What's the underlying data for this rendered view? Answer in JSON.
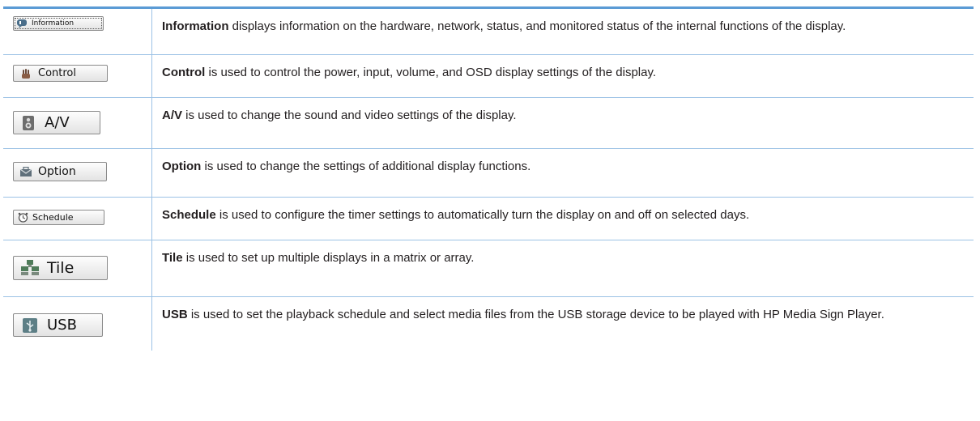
{
  "rows": [
    {
      "button_label": "Information",
      "icon": "info-speech-icon",
      "term": "Information",
      "description": " displays information on the hardware, network, status, and monitored status of the internal functions of the display."
    },
    {
      "button_label": "Control",
      "icon": "hand-icon",
      "term": "Control",
      "description": " is used to control the power, input, volume, and OSD display settings of the display."
    },
    {
      "button_label": "A/V",
      "icon": "speaker-icon",
      "term": "A/V",
      "description": " is used to change the sound and video settings of the display."
    },
    {
      "button_label": "Option",
      "icon": "toolbox-icon",
      "term": "Option",
      "description": " is used to change the settings of additional display functions."
    },
    {
      "button_label": "Schedule",
      "icon": "clock-icon",
      "term": "Schedule",
      "description": " is used to configure the timer settings to automatically turn the display on and off on selected days."
    },
    {
      "button_label": "Tile",
      "icon": "tile-monitors-icon",
      "term": "Tile",
      "description": " is used to set up multiple displays in a matrix or array."
    },
    {
      "button_label": "USB",
      "icon": "usb-icon",
      "term": "USB",
      "description": " is used to set the playback schedule and select media files from the USB storage device to be played with HP Media Sign Player."
    }
  ],
  "colors": {
    "table_top_rule": "#5b9bd5",
    "table_grid": "#9cc2e5",
    "text": "#231f20"
  }
}
